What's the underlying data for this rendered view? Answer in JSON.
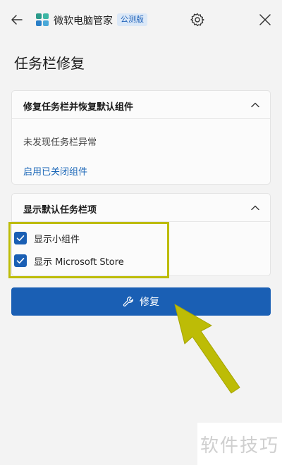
{
  "app": {
    "title": "微软电脑管家",
    "badge": "公测版",
    "icons": {
      "back": "back-arrow-icon",
      "settings": "gear-icon",
      "close": "close-icon"
    }
  },
  "page": {
    "title": "任务栏修复"
  },
  "section_repair": {
    "title": "修复任务栏并恢复默认组件",
    "status": "未发现任务栏异常",
    "link": "启用已关闭组件"
  },
  "section_default": {
    "title": "显示默认任务栏项",
    "items": [
      {
        "label": "显示小组件",
        "checked": true
      },
      {
        "label": "显示 Microsoft Store",
        "checked": true
      }
    ]
  },
  "repair_button": {
    "label": "修复",
    "icon": "wrench-icon"
  },
  "watermark": {
    "text": "软件技巧"
  },
  "colors": {
    "accent": "#1a5fb4",
    "link": "#1a66b7",
    "highlight": "#bdbc06",
    "background": "#f3f3f3"
  }
}
